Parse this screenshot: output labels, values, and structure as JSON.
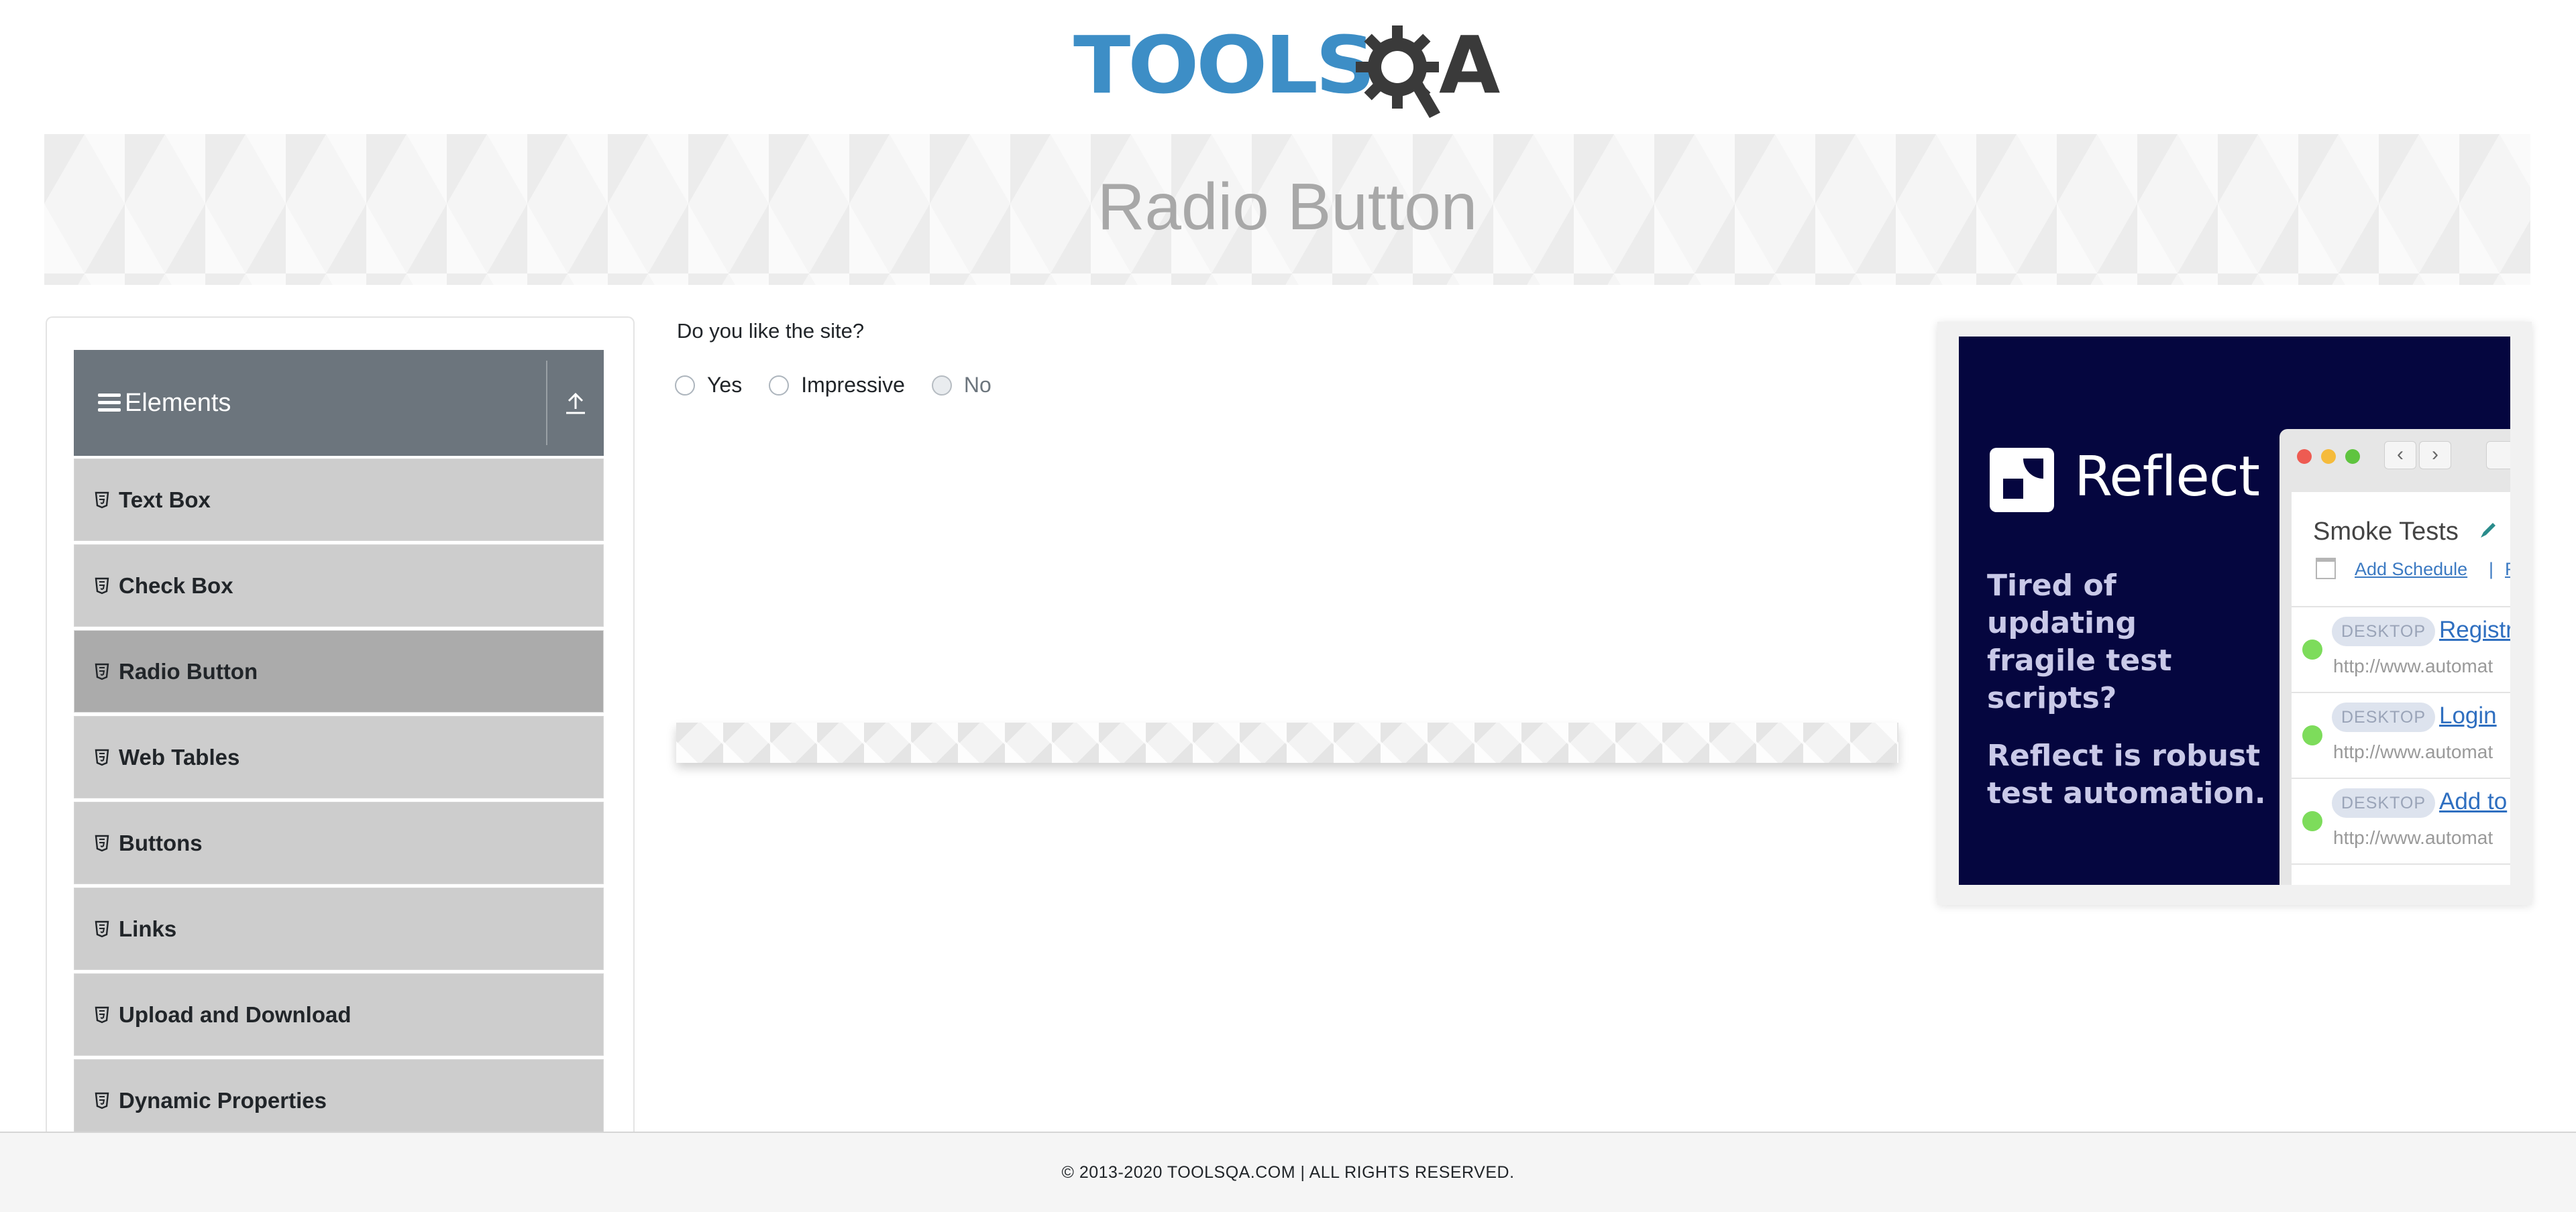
{
  "logo": {
    "part1": "TOOLS",
    "part2": "A"
  },
  "banner": {
    "title": "Radio Button"
  },
  "sidebar": {
    "group_title": "Elements",
    "items": [
      {
        "label": "Text Box",
        "active": false
      },
      {
        "label": "Check Box",
        "active": false
      },
      {
        "label": "Radio Button",
        "active": true
      },
      {
        "label": "Web Tables",
        "active": false
      },
      {
        "label": "Buttons",
        "active": false
      },
      {
        "label": "Links",
        "active": false
      },
      {
        "label": "Upload and Download",
        "active": false
      },
      {
        "label": "Dynamic Properties",
        "active": false
      }
    ]
  },
  "main": {
    "question": "Do you like the site?",
    "options": [
      {
        "label": "Yes",
        "disabled": false
      },
      {
        "label": "Impressive",
        "disabled": false
      },
      {
        "label": "No",
        "disabled": true
      }
    ]
  },
  "ad": {
    "brand": "Reflect",
    "tagline1": "Tired of updating fragile test scripts?",
    "tagline2": "Reflect is robust test automation.",
    "suite_title": "Smoke Tests",
    "schedule_link": "Add Schedule",
    "schedule_sep": "|",
    "schedule_next": "Ru",
    "tests": [
      {
        "tag": "DESKTOP",
        "name": "Registr",
        "url": "http://www.automat"
      },
      {
        "tag": "DESKTOP",
        "name": "Login",
        "url": "http://www.automat"
      },
      {
        "tag": "DESKTOP",
        "name": "Add to",
        "url": "http://www.automat"
      }
    ]
  },
  "footer": {
    "text": "© 2013-2020 TOOLSQA.COM | ALL RIGHTS RESERVED."
  },
  "colors": {
    "logo_blue": "#3d8ec6",
    "logo_dark": "#3a3a3a",
    "group_header_bg": "#6c757d",
    "menu_item_bg": "#cdcdcd",
    "menu_item_active_bg": "#ababab",
    "ad_bg": "#05063f",
    "status_green": "#7ddc5b"
  }
}
